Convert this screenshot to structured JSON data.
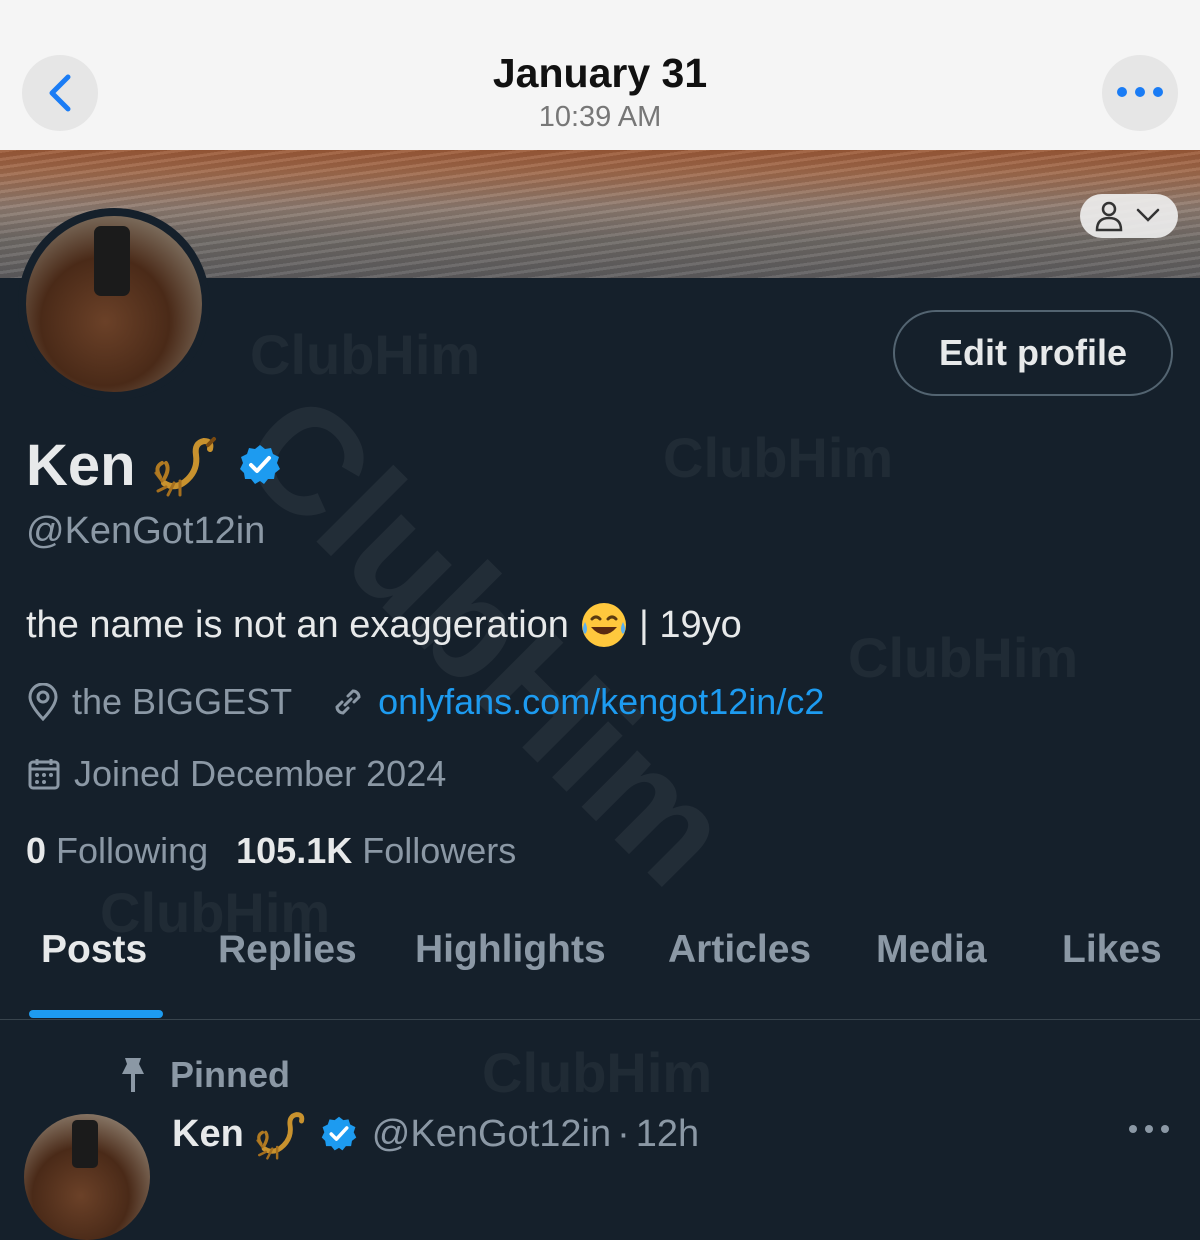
{
  "header": {
    "date": "January 31",
    "time": "10:39 AM"
  },
  "profile": {
    "edit_label": "Edit profile",
    "name": "Ken",
    "handle": "@KenGot12in",
    "bio_before": "the name is not an exaggeration",
    "bio_after": "| 19yo",
    "location": "the BIGGEST",
    "link": "onlyfans.com/kengot12in/c2",
    "joined": "Joined December 2024",
    "following_count": "0",
    "following_label": "Following",
    "followers_count": "105.1K",
    "followers_label": "Followers"
  },
  "tabs": [
    {
      "label": "Posts"
    },
    {
      "label": "Replies"
    },
    {
      "label": "Highlights"
    },
    {
      "label": "Articles"
    },
    {
      "label": "Media"
    },
    {
      "label": "Likes"
    }
  ],
  "post": {
    "pinned_label": "Pinned",
    "name": "Ken",
    "handle": "@KenGot12in",
    "sep": "·",
    "age": "12h"
  },
  "watermark": "ClubHim",
  "colors": {
    "accent": "#1d9bf0",
    "background": "#15202b",
    "muted_text": "#8b98a5"
  }
}
